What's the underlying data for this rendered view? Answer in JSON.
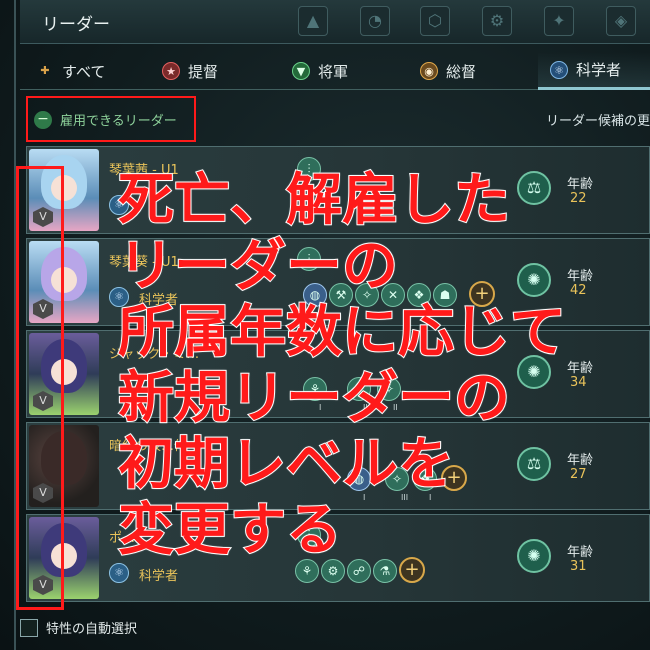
{
  "window": {
    "title": "リーダー"
  },
  "tabs": [
    {
      "label": "すべて",
      "icon": "all-icon",
      "color": "#d9a24a"
    },
    {
      "label": "提督",
      "icon": "admiral-icon",
      "color": "#c23b3b"
    },
    {
      "label": "将軍",
      "icon": "general-icon",
      "color": "#3aa05a"
    },
    {
      "label": "総督",
      "icon": "governor-icon",
      "color": "#c98a2a"
    },
    {
      "label": "科学者",
      "icon": "scientist-icon",
      "color": "#3d7fb0"
    }
  ],
  "filter": {
    "label": "雇用できるリーダー"
  },
  "sort": {
    "label": "リーダー候補の更"
  },
  "leaders": [
    {
      "name": "琴葉茜 - U1",
      "class": "",
      "age_label": "年齢",
      "age": "22",
      "portrait": "blue"
    },
    {
      "name": "琴葉葵 - U1",
      "class": "科学者",
      "age_label": "年齢",
      "age": "42",
      "portrait": "blue"
    },
    {
      "name": "ジャック・ミ…",
      "class": "",
      "age_label": "年齢",
      "age": "34",
      "portrait": "green"
    },
    {
      "name": "暗紅の仮…体",
      "class": "",
      "age_label": "年齢",
      "age": "27",
      "portrait": "dark"
    },
    {
      "name": "ポ…",
      "class": "科学者",
      "age_label": "年齢",
      "age": "31",
      "portrait": "green"
    }
  ],
  "trait_numerals": [
    "I",
    "II",
    "III"
  ],
  "auto_select": {
    "label": "特性の自動選択"
  },
  "caption": {
    "lines": [
      "死亡、解雇した",
      "リーダーの",
      "所属年数に応じて",
      "新規リーダーの",
      "初期レベルを",
      "変更する"
    ],
    "color": "#ff1a1a"
  }
}
